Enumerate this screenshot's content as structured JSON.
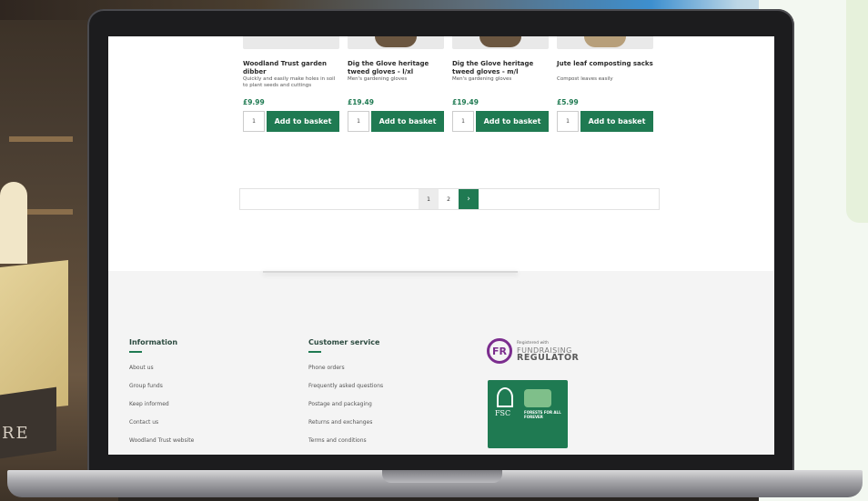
{
  "background": {
    "block_text": "RE"
  },
  "products": [
    {
      "name": "Woodland Trust garden dibber",
      "description": "Quickly and easily make holes in soil to plant seeds and cuttings",
      "price": "£9.99",
      "quantity": "1",
      "button_label": "Add to basket",
      "thumb": "plain"
    },
    {
      "name": "Dig the Glove heritage tweed gloves - l/xl",
      "description": "Men's gardening gloves",
      "price": "£19.49",
      "quantity": "1",
      "button_label": "Add to basket",
      "thumb": "glove"
    },
    {
      "name": "Dig the Glove heritage tweed gloves - m/l",
      "description": "Men's gardening gloves",
      "price": "£19.49",
      "quantity": "1",
      "button_label": "Add to basket",
      "thumb": "glove"
    },
    {
      "name": "Jute leaf composting sacks",
      "description": "Compost leaves easily",
      "price": "£5.99",
      "quantity": "1",
      "button_label": "Add to basket",
      "thumb": "sack"
    }
  ],
  "pagination": {
    "pages": [
      "1",
      "2"
    ],
    "current": "1",
    "next_icon": "chevron-right-icon",
    "next_glyph": "›"
  },
  "footer": {
    "information": {
      "title": "Information",
      "links": [
        "About us",
        "Group funds",
        "Keep informed",
        "Contact us",
        "Woodland Trust website"
      ]
    },
    "customer_service": {
      "title": "Customer service",
      "links": [
        "Phone orders",
        "Frequently asked questions",
        "Postage and packaging",
        "Returns and exchanges",
        "Terms and conditions"
      ]
    },
    "fundraising_regulator": {
      "badge": "FR",
      "registered": "Registered with",
      "line1": "FUNDRAISING",
      "line2": "REGULATOR"
    },
    "fsc": {
      "word": "FSC",
      "forests": "FORESTS FOR ALL FOREVER"
    }
  },
  "colors": {
    "brand_green": "#1f7a52",
    "fr_purple": "#7b2d8e"
  }
}
